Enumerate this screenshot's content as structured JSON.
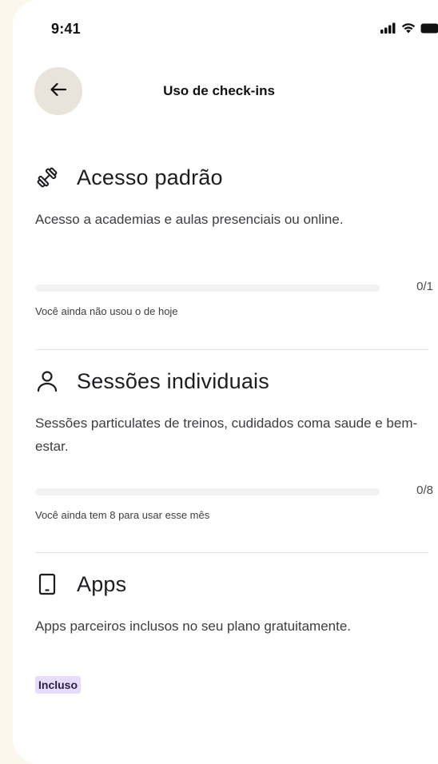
{
  "status_bar": {
    "time": "9:41",
    "icons": [
      "signal-icon",
      "wifi-icon",
      "battery-icon"
    ]
  },
  "header": {
    "back_icon": "arrow-left-icon",
    "title": "Uso de check-ins"
  },
  "sections": [
    {
      "icon": "dumbbell-icon",
      "title": "Acesso padrão",
      "description": "Acesso a academias e aulas presenciais ou online.",
      "progress": {
        "used": 0,
        "total": 1,
        "label": "0/1",
        "fraction": 0
      },
      "note": "Você ainda não usou o de hoje"
    },
    {
      "icon": "person-icon",
      "title": "Sessões individuais",
      "description": "Sessões particulates de treinos, cudidados coma saude e bem-estar.",
      "progress": {
        "used": 0,
        "total": 8,
        "label": "0/8",
        "fraction": 0
      },
      "note": "Você ainda tem 8 para usar esse mês"
    },
    {
      "icon": "smartphone-icon",
      "title": "Apps",
      "description": "Apps parceiros inclusos no seu plano gratuitamente.",
      "badge": "Incluso"
    }
  ],
  "colors": {
    "background": "#fbf7ea",
    "card": "#ffffff",
    "back_button": "#e8e4dc",
    "progress_track": "#f2f2f2",
    "badge_bg": "#e7dcfb"
  }
}
